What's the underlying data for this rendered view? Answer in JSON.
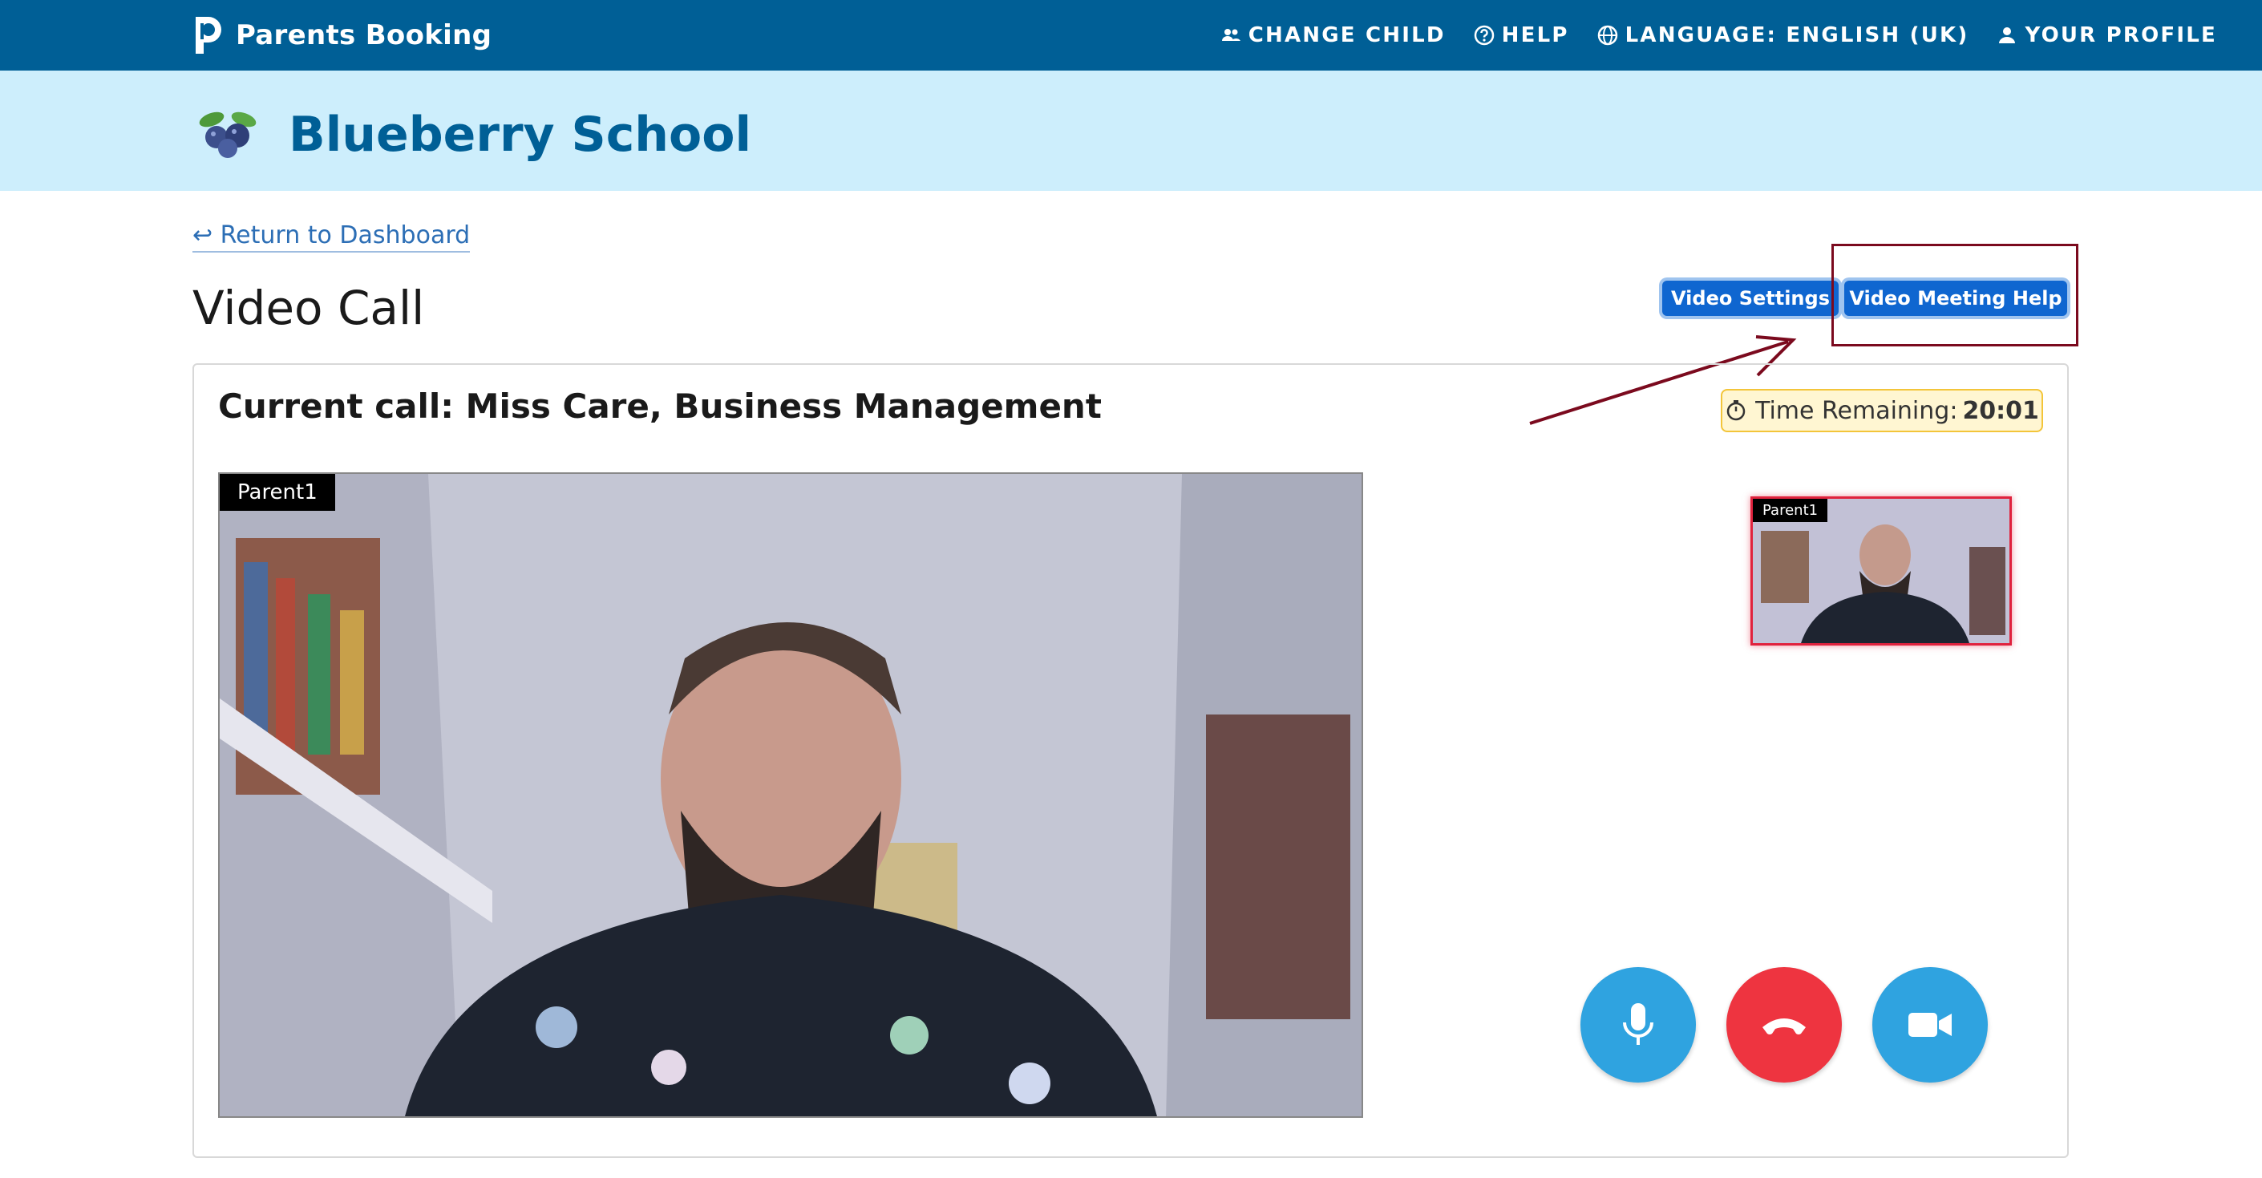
{
  "header": {
    "brand_name": "Parents Booking",
    "nav": [
      {
        "label": "CHANGE CHILD",
        "icon": "people-icon"
      },
      {
        "label": "HELP",
        "icon": "question-icon"
      },
      {
        "label": "LANGUAGE: ENGLISH (UK)",
        "icon": "globe-icon"
      },
      {
        "label": "YOUR PROFILE",
        "icon": "person-icon"
      }
    ],
    "color": "#005f96"
  },
  "school": {
    "name": "Blueberry School",
    "logo_icon": "blueberry-icon",
    "banner_color": "#cdeefc"
  },
  "page": {
    "return_link": "↩ Return to Dashboard",
    "title": "Video Call",
    "buttons": {
      "video_settings": "Video Settings",
      "video_meeting_help": "Video Meeting Help"
    }
  },
  "call": {
    "title": "Current call: Miss Care, Business Management",
    "timer_label": "Time Remaining:",
    "timer_value": "20:01",
    "main_video_label": "Parent1",
    "self_video_label": "Parent1",
    "controls": [
      {
        "name": "microphone",
        "icon": "microphone-icon"
      },
      {
        "name": "hang-up",
        "icon": "phone-hangup-icon"
      },
      {
        "name": "camera",
        "icon": "video-camera-icon"
      }
    ]
  },
  "annotation": {
    "highlight_color": "#7b0a1e"
  }
}
